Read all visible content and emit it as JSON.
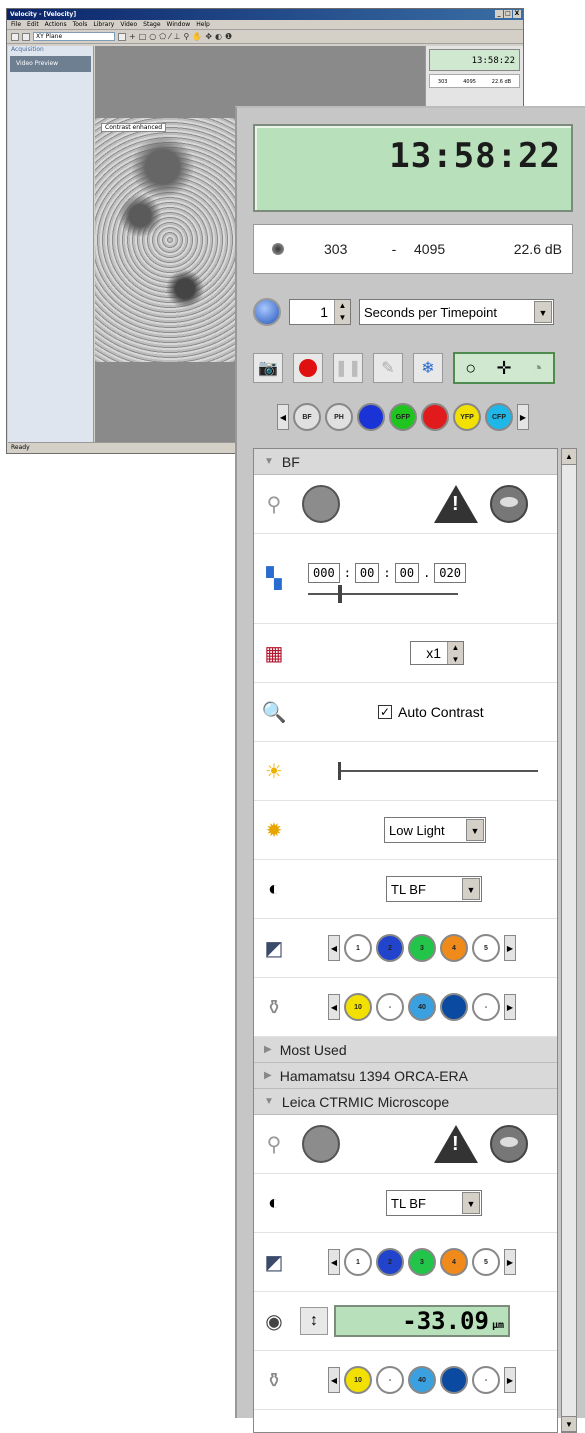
{
  "app": {
    "title": "Velocity - [Velocity]",
    "window_buttons": [
      "_",
      "□",
      "X"
    ],
    "menu": [
      "File",
      "Edit",
      "Actions",
      "Tools",
      "Library",
      "Video",
      "Stage",
      "Window",
      "Help"
    ],
    "plane_combo": "XY Plane",
    "sidebar": {
      "header": "Acquisition",
      "item": "Video Preview"
    },
    "viewport_label": "Contrast enhanced",
    "mini_clock": "13:58:22",
    "mini_exposure": [
      "303",
      "4095",
      "22.6 dB"
    ],
    "status": "Ready"
  },
  "panel": {
    "clock": "13:58:22",
    "exposure": {
      "min": "303",
      "sep": "-",
      "max": "4095",
      "db": "22.6 dB"
    },
    "timepoint": {
      "value": "1",
      "unit": "Seconds per Timepoint"
    },
    "channels": [
      "BF",
      "PH",
      "",
      "GFP",
      "",
      "YFP",
      "CFP"
    ],
    "channel_colors": [
      "#e0e0e0",
      "#e0e0e0",
      "#1a33d6",
      "#1fc41f",
      "#e11b1b",
      "#f2e000",
      "#1fb7e8"
    ],
    "sections": {
      "bf": "BF",
      "most_used": "Most Used",
      "camera": "Hamamatsu 1394 ORCA-ERA",
      "microscope": "Leica CTRMIC Microscope"
    },
    "exposure_time": [
      "000",
      "00",
      "00",
      "020"
    ],
    "binning": "x1",
    "auto_contrast": "Auto Contrast",
    "sensitivity": "Low Light",
    "contrast_method": "TL BF",
    "filter_positions": [
      "1",
      "2",
      "3",
      "4",
      "5"
    ],
    "filter_colors": [
      "#ffffff",
      "#2244cc",
      "#22c44a",
      "#f08a1a",
      "#ffffff"
    ],
    "objectives": [
      "10",
      "-",
      "40",
      "",
      "-"
    ],
    "objective_colors": [
      "#f2e000",
      "#ffffff",
      "#3aa0e0",
      "#0a4aa0",
      "#ffffff"
    ],
    "microscope_method": "TL BF",
    "focus": {
      "value": "-33.09",
      "unit": "µm"
    }
  }
}
